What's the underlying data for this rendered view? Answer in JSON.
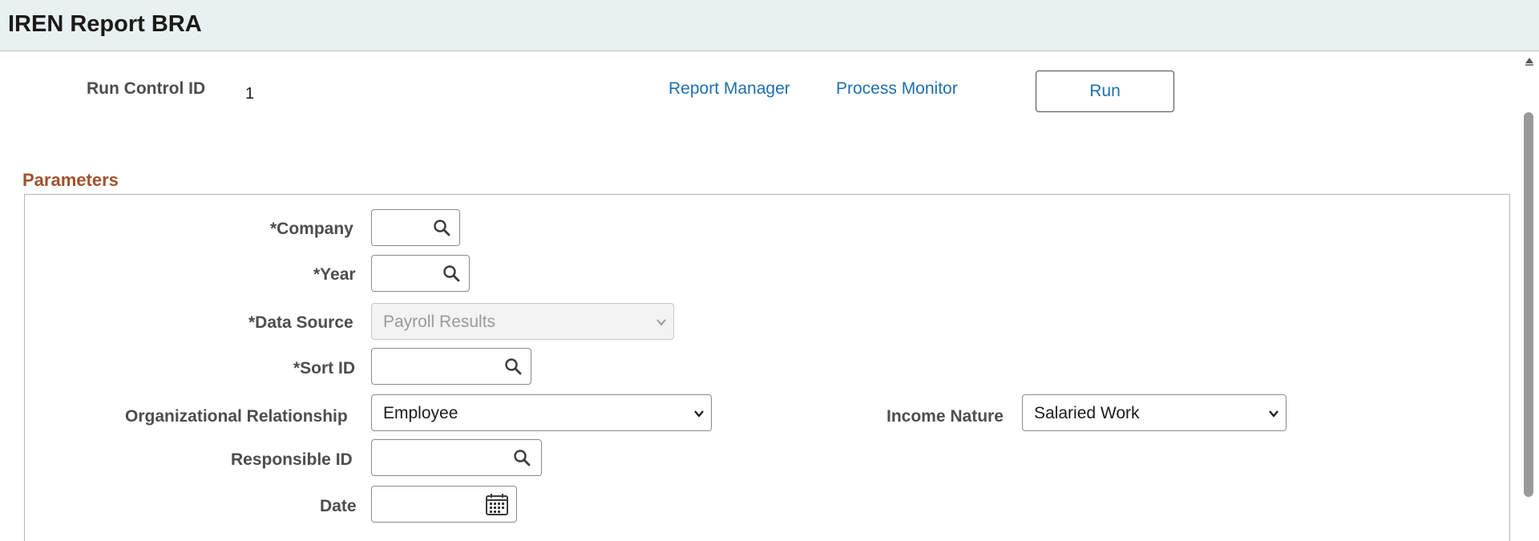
{
  "title": "IREN Report BRA",
  "run_control": {
    "label": "Run Control ID",
    "value": "1"
  },
  "links": {
    "report_manager": "Report Manager",
    "process_monitor": "Process Monitor"
  },
  "run_button": "Run",
  "section": {
    "title": "Parameters"
  },
  "fields": {
    "company": {
      "label": "*Company",
      "value": ""
    },
    "year": {
      "label": "*Year",
      "value": ""
    },
    "data_source": {
      "label": "*Data Source",
      "value": "Payroll Results"
    },
    "sort_id": {
      "label": "*Sort ID",
      "value": ""
    },
    "org_relationship": {
      "label": "Organizational Relationship",
      "value": "Employee"
    },
    "income_nature": {
      "label": "Income Nature",
      "value": "Salaried Work"
    },
    "responsible_id": {
      "label": "Responsible ID",
      "value": ""
    },
    "date": {
      "label": "Date",
      "value": ""
    }
  },
  "icons": {
    "lookup": "search-icon",
    "calendar": "calendar-icon",
    "dropdown": "chevron-down-icon",
    "scroll_up": "scroll-up-arrow-icon"
  },
  "colors": {
    "header_bg": "#e8f0f0",
    "link": "#1f6fae",
    "section_title": "#a0522d",
    "label": "#4d4d4d"
  }
}
